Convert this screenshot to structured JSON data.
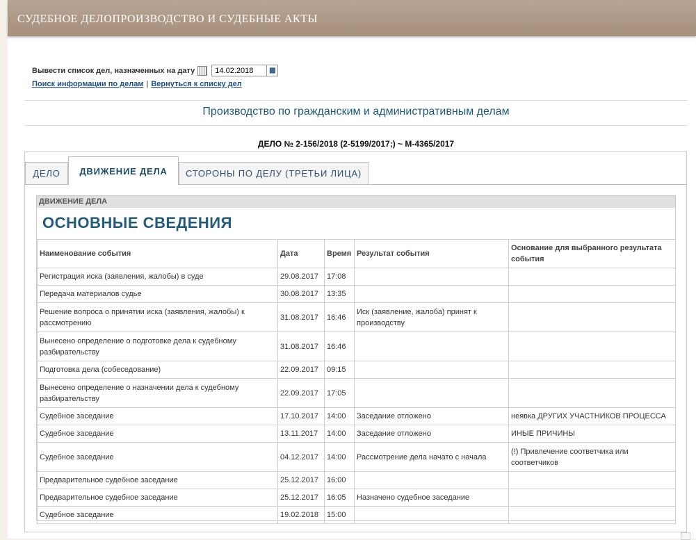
{
  "header": {
    "title": "СУДЕБНОЕ ДЕЛОПРОИЗВОДСТВО И СУДЕБНЫЕ АКТЫ"
  },
  "date_filter": {
    "label": "Вывести список дел, назначенных на дату",
    "value": "14.02.2018"
  },
  "links": {
    "search": "Поиск информации по делам",
    "back": "Вернуться к списку дел",
    "separator": "|"
  },
  "section_title": "Производство по гражданским и административным делам",
  "case_number": "ДЕЛО № 2-156/2018 (2-5199/2017;) ~ М-4365/2017",
  "tabs": [
    {
      "label": "ДЕЛО",
      "active": false
    },
    {
      "label": "ДВИЖЕНИЕ ДЕЛА",
      "active": true
    },
    {
      "label": "СТОРОНЫ ПО ДЕЛУ (ТРЕТЬИ ЛИЦА)",
      "active": false
    }
  ],
  "panel": {
    "header": "ДВИЖЕНИЕ ДЕЛА",
    "title": "ОСНОВНЫЕ СВЕДЕНИЯ",
    "columns": [
      "Наименование события",
      "Дата",
      "Время",
      "Результат события",
      "Основание для выбранного результата события"
    ],
    "rows": [
      {
        "event": "Регистрация иска (заявления, жалобы) в суде",
        "date": "29.08.2017",
        "time": "17:08",
        "result": "",
        "basis": ""
      },
      {
        "event": "Передача материалов судье",
        "date": "30.08.2017",
        "time": "13:35",
        "result": "",
        "basis": ""
      },
      {
        "event": "Решение вопроса о принятии иска (заявления, жалобы) к рассмотрению",
        "date": "31.08.2017",
        "time": "16:46",
        "result": "Иск (заявление, жалоба) принят к производству",
        "basis": ""
      },
      {
        "event": "Вынесено определение о подготовке дела к судебному разбирательству",
        "date": "31.08.2017",
        "time": "16:46",
        "result": "",
        "basis": ""
      },
      {
        "event": "Подготовка дела (собеседование)",
        "date": "22.09.2017",
        "time": "09:15",
        "result": "",
        "basis": ""
      },
      {
        "event": "Вынесено определение о назначении дела к судебному разбирательству",
        "date": "22.09.2017",
        "time": "17:05",
        "result": "",
        "basis": ""
      },
      {
        "event": "Судебное заседание",
        "date": "17.10.2017",
        "time": "14:00",
        "result": "Заседание отложено",
        "basis": "неявка ДРУГИХ УЧАСТНИКОВ ПРОЦЕССА"
      },
      {
        "event": "Судебное заседание",
        "date": "13.11.2017",
        "time": "14:00",
        "result": "Заседание отложено",
        "basis": "ИНЫЕ ПРИЧИНЫ"
      },
      {
        "event": "Судебное заседание",
        "date": "04.12.2017",
        "time": "14:00",
        "result": "Рассмотрение дела начато с начала",
        "basis": "(!) Привлечение соответчика или соответчиков"
      },
      {
        "event": "Предварительное судебное заседание",
        "date": "25.12.2017",
        "time": "16:00",
        "result": "",
        "basis": ""
      },
      {
        "event": "Предварительное судебное заседание",
        "date": "25.12.2017",
        "time": "16:05",
        "result": "Назначено судебное заседание",
        "basis": ""
      },
      {
        "event": "Судебное заседание",
        "date": "19.02.2018",
        "time": "15:00",
        "result": "",
        "basis": ""
      }
    ]
  },
  "icons": {
    "calendar": "calendar-icon",
    "clear": "clear-date-icon"
  },
  "colors": {
    "header_bg": "#a68f7b",
    "link": "#1e4f86",
    "title": "#225b7c"
  }
}
